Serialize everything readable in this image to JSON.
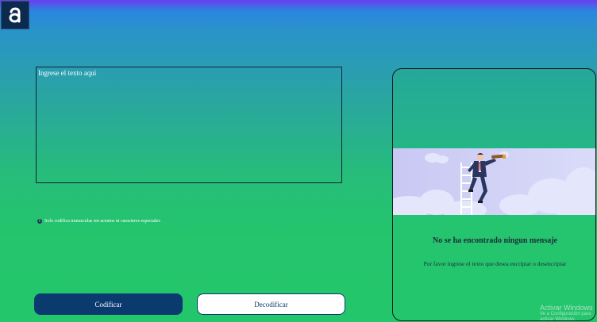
{
  "app": {
    "logo_letter": "a"
  },
  "input": {
    "placeholder": "Ingrese el texto aquí",
    "value": ""
  },
  "notice": {
    "icon": "info-icon",
    "text": "Solo codifica minusculas sin acentos ni caracteres especiales"
  },
  "buttons": {
    "encode_label": "Codificar",
    "decode_label": "Decodificar"
  },
  "result_panel": {
    "illustration": "man-with-telescope-on-ladder",
    "title": "No se ha encontrado ningun mensaje",
    "text": "Por favor ingrese el texto que desea encriptar o desencriptar"
  },
  "watermark": {
    "title": "Activar Windows",
    "subtitle": "Ve a Configuración para activar Windows."
  },
  "colors": {
    "primary": "#0b3a6e",
    "background_top": "#2a86e0",
    "background_bottom": "#23c66b"
  }
}
